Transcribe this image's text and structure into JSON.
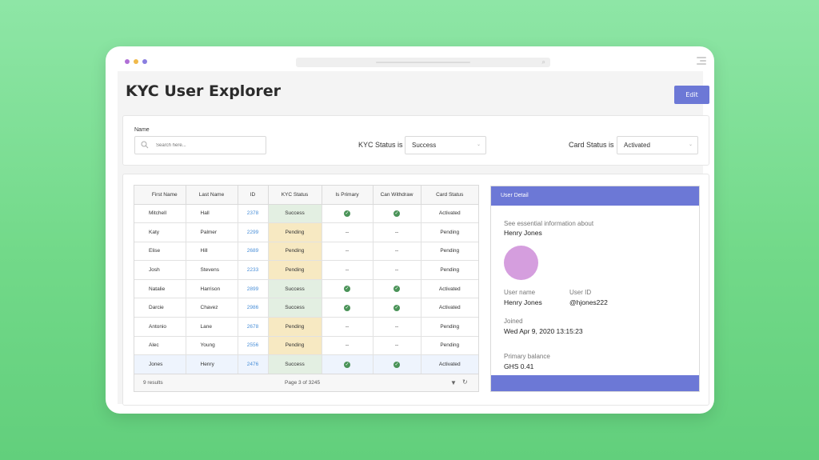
{
  "app": {
    "title": "KYC User Explorer",
    "edit_label": "Edit"
  },
  "filters": {
    "name_label": "Name",
    "search_placeholder": "Search here...",
    "kyc_label": "KYC Status is",
    "kyc_value": "Success",
    "card_label": "Card Status is",
    "card_value": "Activated"
  },
  "table": {
    "columns": [
      "First Name",
      "Last Name",
      "ID",
      "KYC Status",
      "Is Primary",
      "Can Withdraw",
      "Card Status"
    ],
    "rows": [
      {
        "first": "Mitchell",
        "last": "Hall",
        "id": "2378",
        "kyc": "Success",
        "primary": true,
        "withdraw": true,
        "card": "Activated"
      },
      {
        "first": "Katy",
        "last": "Palmer",
        "id": "2299",
        "kyc": "Pending",
        "primary": false,
        "withdraw": false,
        "card": "Pending"
      },
      {
        "first": "Elise",
        "last": "Hill",
        "id": "2689",
        "kyc": "Pending",
        "primary": false,
        "withdraw": false,
        "card": "Pending"
      },
      {
        "first": "Josh",
        "last": "Stevens",
        "id": "2233",
        "kyc": "Pending",
        "primary": false,
        "withdraw": false,
        "card": "Pending"
      },
      {
        "first": "Natalie",
        "last": "Harrison",
        "id": "2899",
        "kyc": "Success",
        "primary": true,
        "withdraw": true,
        "card": "Activated"
      },
      {
        "first": "Darcie",
        "last": "Chavez",
        "id": "2986",
        "kyc": "Success",
        "primary": true,
        "withdraw": true,
        "card": "Activated"
      },
      {
        "first": "Antonio",
        "last": "Lane",
        "id": "2678",
        "kyc": "Pending",
        "primary": false,
        "withdraw": false,
        "card": "Pending"
      },
      {
        "first": "Alec",
        "last": "Young",
        "id": "2556",
        "kyc": "Pending",
        "primary": false,
        "withdraw": false,
        "card": "Pending"
      },
      {
        "first": "Jones",
        "last": "Henry",
        "id": "2476",
        "kyc": "Success",
        "primary": true,
        "withdraw": true,
        "card": "Activated",
        "selected": true
      }
    ],
    "empty_marker": "--",
    "results_label": "9 results",
    "page_label": "Page 3 of 3245"
  },
  "detail": {
    "header": "User Detail",
    "intro": "See essential information about",
    "name": "Henry Jones",
    "username_label": "User name",
    "username_value": "Henry Jones",
    "userid_label": "User ID",
    "userid_value": "@hjones222",
    "joined_label": "Joined",
    "joined_value": "Wed Apr 9, 2020 13:15:23",
    "balance_label": "Primary balance",
    "balance_value": "GHS 0.41"
  },
  "colors": {
    "accent": "#6c78d6",
    "success_bg": "#e3efe2",
    "pending_bg": "#f7e9c2",
    "link": "#4a8fd8",
    "avatar": "#d59ede"
  },
  "icons": {
    "window_controls": [
      "close-dot",
      "minimize-dot",
      "maximize-dot"
    ],
    "search": "search-icon",
    "check": "check-circle-icon",
    "filter": "filter-icon",
    "refresh": "refresh-icon"
  }
}
